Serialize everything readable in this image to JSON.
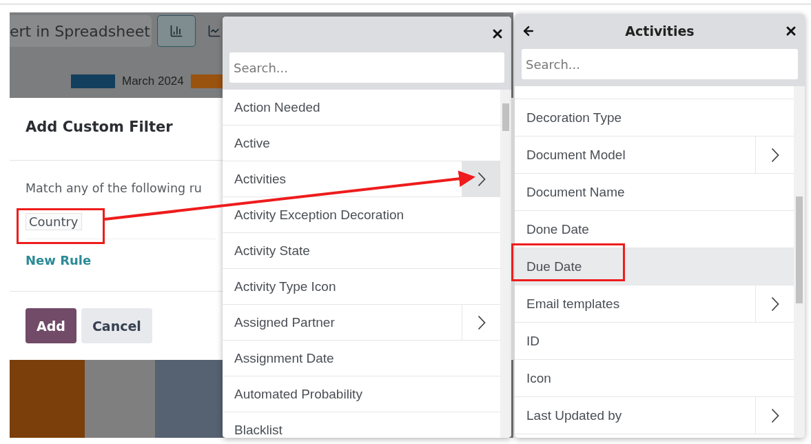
{
  "background": {
    "toolbar_button": "ert in Spreadsheet",
    "chart_types": [
      {
        "kind": "bar",
        "selected": true
      },
      {
        "kind": "line",
        "selected": false
      }
    ],
    "legend_label": "March 2024"
  },
  "dialog": {
    "title": "Add Custom Filter",
    "description": "Match any of the following ru",
    "rule_field": "Country",
    "new_rule_link": "New Rule",
    "buttons": [
      {
        "label": "Add",
        "kind": "primary"
      },
      {
        "label": "Cancel",
        "kind": "secondary"
      }
    ]
  },
  "field_menu": {
    "search": {
      "placeholder": "Search..."
    },
    "items": [
      {
        "label": "Action Needed",
        "has_submenu": false,
        "selected": false
      },
      {
        "label": "Active",
        "has_submenu": false,
        "selected": false
      },
      {
        "label": "Activities",
        "has_submenu": true,
        "selected": true
      },
      {
        "label": "Activity Exception Decoration",
        "has_submenu": false,
        "selected": false
      },
      {
        "label": "Activity State",
        "has_submenu": false,
        "selected": false
      },
      {
        "label": "Activity Type Icon",
        "has_submenu": false,
        "selected": false
      },
      {
        "label": "Assigned Partner",
        "has_submenu": true,
        "selected": false
      },
      {
        "label": "Assignment Date",
        "has_submenu": false,
        "selected": false
      },
      {
        "label": "Automated Probability",
        "has_submenu": false,
        "selected": false
      },
      {
        "label": "Blacklist",
        "has_submenu": false,
        "selected": false
      }
    ]
  },
  "submenu": {
    "title": "Activities",
    "search": {
      "placeholder": "Search..."
    },
    "items": [
      {
        "label": "Decoration Type",
        "has_submenu": false,
        "selected": false
      },
      {
        "label": "Document Model",
        "has_submenu": true,
        "selected": false
      },
      {
        "label": "Document Name",
        "has_submenu": false,
        "selected": false
      },
      {
        "label": "Done Date",
        "has_submenu": false,
        "selected": false
      },
      {
        "label": "Due Date",
        "has_submenu": false,
        "selected": true
      },
      {
        "label": "Email templates",
        "has_submenu": true,
        "selected": false
      },
      {
        "label": "ID",
        "has_submenu": false,
        "selected": false
      },
      {
        "label": "Icon",
        "has_submenu": false,
        "selected": false
      },
      {
        "label": "Last Updated by",
        "has_submenu": true,
        "selected": false
      }
    ]
  }
}
